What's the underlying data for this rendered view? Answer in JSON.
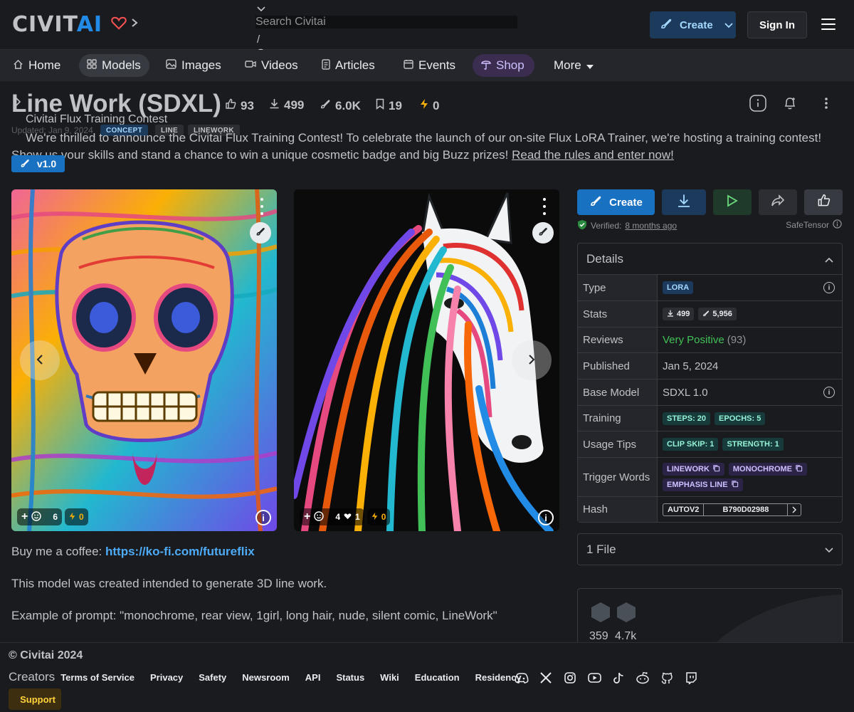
{
  "header": {
    "logo_main": "CIVIT",
    "logo_ai": "AI",
    "search_placeholder": "Search Civitai",
    "search_slash": "/",
    "create_label": "Create",
    "signin_label": "Sign In"
  },
  "nav": {
    "items": [
      {
        "label": "Home",
        "icon": "home-icon"
      },
      {
        "label": "Models",
        "icon": "grid-icon"
      },
      {
        "label": "Images",
        "icon": "image-icon"
      },
      {
        "label": "Videos",
        "icon": "video-icon"
      },
      {
        "label": "Articles",
        "icon": "article-icon"
      },
      {
        "label": "Events",
        "icon": "calendar-icon"
      },
      {
        "label": "Shop",
        "icon": "shop-icon"
      },
      {
        "label": "More",
        "icon": "caret-down-icon"
      }
    ]
  },
  "model": {
    "title": "Line Work (SDXL)",
    "stats": {
      "likes": "93",
      "downloads": "499",
      "generations": "6.0K",
      "bookmarks": "19",
      "buzz": "0"
    },
    "updated": "Updated: Jan 9, 2024",
    "tags": [
      "CONCEPT",
      "LINE",
      "LINEWORK"
    ],
    "version": "v1.0"
  },
  "banner": {
    "title": "Civitai Flux Training Contest",
    "icon": "",
    "text": "We're thrilled to announce the Civitai Flux Training Contest! To celebrate the launch of our on-site Flux LoRA Trainer, we're hosting a training contest! Show us your skills and stand a chance to win a unique cosmetic badge and big Buzz prizes!",
    "link": "Read the rules and enter now!"
  },
  "gallery": [
    {
      "comments": "6",
      "buzz": "0",
      "icon_glyph": ""
    },
    {
      "comments": "4",
      "likes": "1",
      "buzz": "0",
      "icon_glyph": ""
    }
  ],
  "description": {
    "coffee_label": "Buy me a coffee:",
    "coffee_link": "https://ko-fi.com/futureflix",
    "line1": "This model was created intended to generate 3D line work.",
    "line2": "Example of prompt: \"monochrome, rear view, 1girl, long hair, nude, silent comic, LineWork\""
  },
  "actions": {
    "create_label": "Create",
    "verified_label": "Verified:",
    "verified_when": "8 months ago",
    "safetensor": "SafeTensor"
  },
  "details": {
    "title": "Details",
    "rows": {
      "type_label": "Type",
      "type_value": "LORA",
      "stats_label": "Stats",
      "stats_downloads": "499",
      "stats_generations": "5,956",
      "reviews_label": "Reviews",
      "reviews_value": "Very Positive",
      "reviews_count": "(93)",
      "published_label": "Published",
      "published_value": "Jan 5, 2024",
      "base_label": "Base Model",
      "base_value": "SDXL 1.0",
      "training_label": "Training",
      "steps": "STEPS: 20",
      "epochs": "EPOCHS: 5",
      "usage_label": "Usage Tips",
      "clip": "CLIP SKIP: 1",
      "strength": "STRENGTH: 1",
      "trigger_label": "Trigger Words",
      "triggers": [
        "LINEWORK",
        "MONOCHROME",
        "EMPHASIS LINE"
      ],
      "hash_label": "Hash",
      "hash_type": "AUTOV2",
      "hash_value": "B790D02988"
    }
  },
  "files": {
    "label": "1 File"
  },
  "creator": {
    "followers": "359",
    "uploads": "4.7k"
  },
  "footer": {
    "copyright": "© Civitai 2024",
    "creators": "Creators",
    "links": [
      "Terms of Service",
      "Privacy",
      "Safety",
      "Newsroom",
      "API",
      "Status",
      "Wiki",
      "Education",
      "Residency"
    ],
    "support_icon": "",
    "support": "Support"
  },
  "colors": {
    "accent": "#228be6",
    "bg": "#1a1b1e",
    "positive": "#40c057",
    "buzz": "#fab005"
  }
}
